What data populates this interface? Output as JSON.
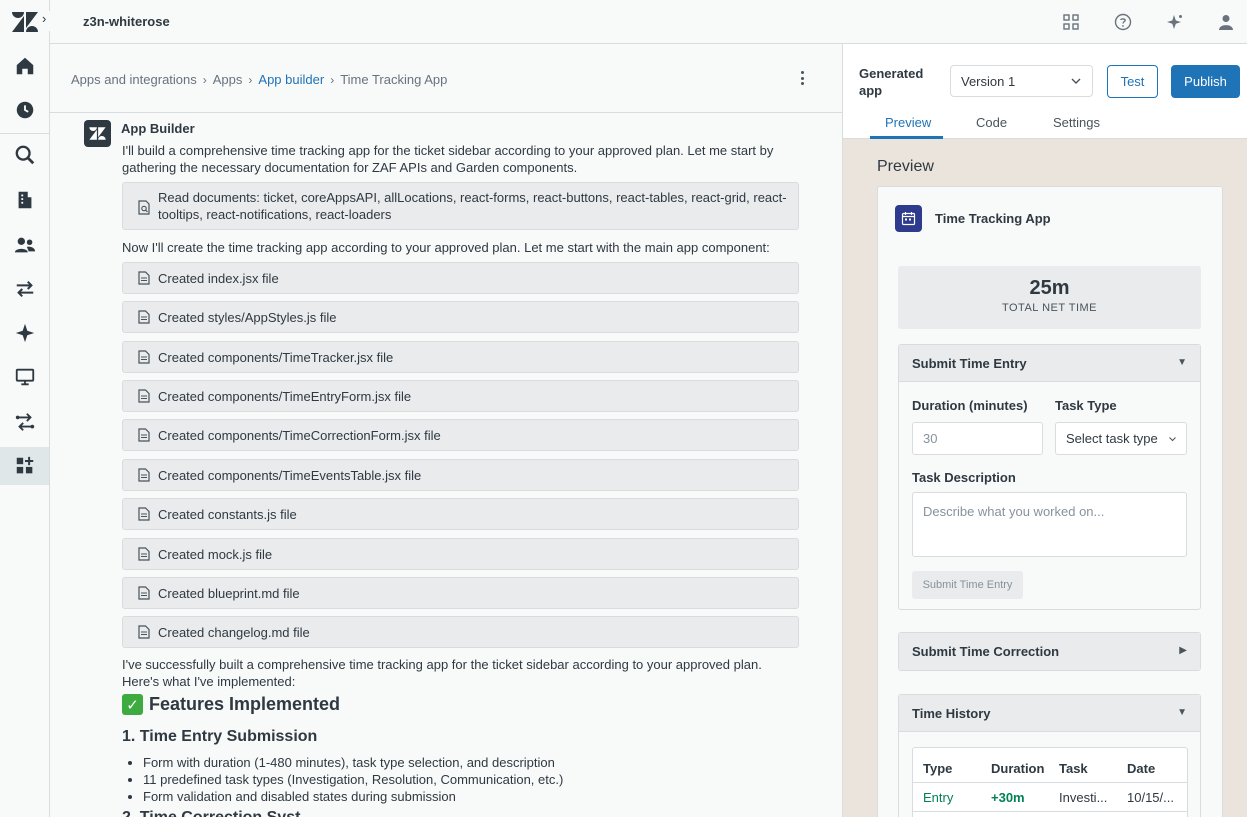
{
  "header": {
    "org_name": "z3n-whiterose"
  },
  "breadcrumbs": [
    {
      "label": "Apps and integrations"
    },
    {
      "label": "Apps"
    },
    {
      "label": "App builder"
    },
    {
      "label": "Time Tracking App"
    }
  ],
  "chat": {
    "bot_name": "App Builder",
    "intro": "I'll build a comprehensive time tracking app for the ticket sidebar according to your approved plan. Let me start by gathering the necessary documentation for ZAF APIs and Garden components.",
    "read_docs": "Read documents: ticket, coreAppsAPI, allLocations, react-forms, react-buttons, react-tables, react-grid, react-tooltips, react-notifications, react-loaders",
    "create_intro": "Now I'll create the time tracking app according to your approved plan. Let me start with the main app component:",
    "files": [
      "Created index.jsx file",
      "Created styles/AppStyles.js file",
      "Created components/TimeTracker.jsx file",
      "Created components/TimeEntryForm.jsx file",
      "Created components/TimeCorrectionForm.jsx file",
      "Created components/TimeEventsTable.jsx file",
      "Created constants.js file",
      "Created mock.js file",
      "Created blueprint.md file",
      "Created changelog.md file"
    ],
    "summary": "I've successfully built a comprehensive time tracking app for the ticket sidebar according to your approved plan. Here's what I've implemented:",
    "features_heading": "Features Implemented",
    "sub_heading": "1. Time Entry Submission",
    "bullets": [
      "Form with duration (1-480 minutes), task type selection, and description",
      "11 predefined task types (Investigation, Resolution, Communication, etc.)",
      "Form validation and disabled states during submission"
    ],
    "cut_heading": "2. Time Correction Syst..."
  },
  "right_panel": {
    "generated_label": "Generated app",
    "version_value": "Version 1",
    "test_label": "Test",
    "publish_label": "Publish",
    "tabs": [
      {
        "label": "Preview"
      },
      {
        "label": "Code"
      },
      {
        "label": "Settings"
      }
    ],
    "preview_title": "Preview",
    "app": {
      "title": "Time Tracking App",
      "total_value": "25m",
      "total_label": "TOTAL NET TIME",
      "submit_section": "Submit Time Entry",
      "duration_label": "Duration (minutes)",
      "duration_placeholder": "30",
      "task_type_label": "Task Type",
      "task_type_value": "Select task type",
      "desc_label": "Task Description",
      "desc_placeholder": "Describe what you worked on...",
      "submit_button": "Submit Time Entry",
      "correction_section": "Submit Time Correction",
      "history_section": "Time History",
      "table_headers": [
        "Type",
        "Duration",
        "Task",
        "Date"
      ],
      "table_row": [
        "Entry",
        "+30m",
        "Investi...",
        "10/15/..."
      ]
    }
  },
  "colors": {
    "accent": "#1f73b7",
    "entry_green": "#038153"
  }
}
